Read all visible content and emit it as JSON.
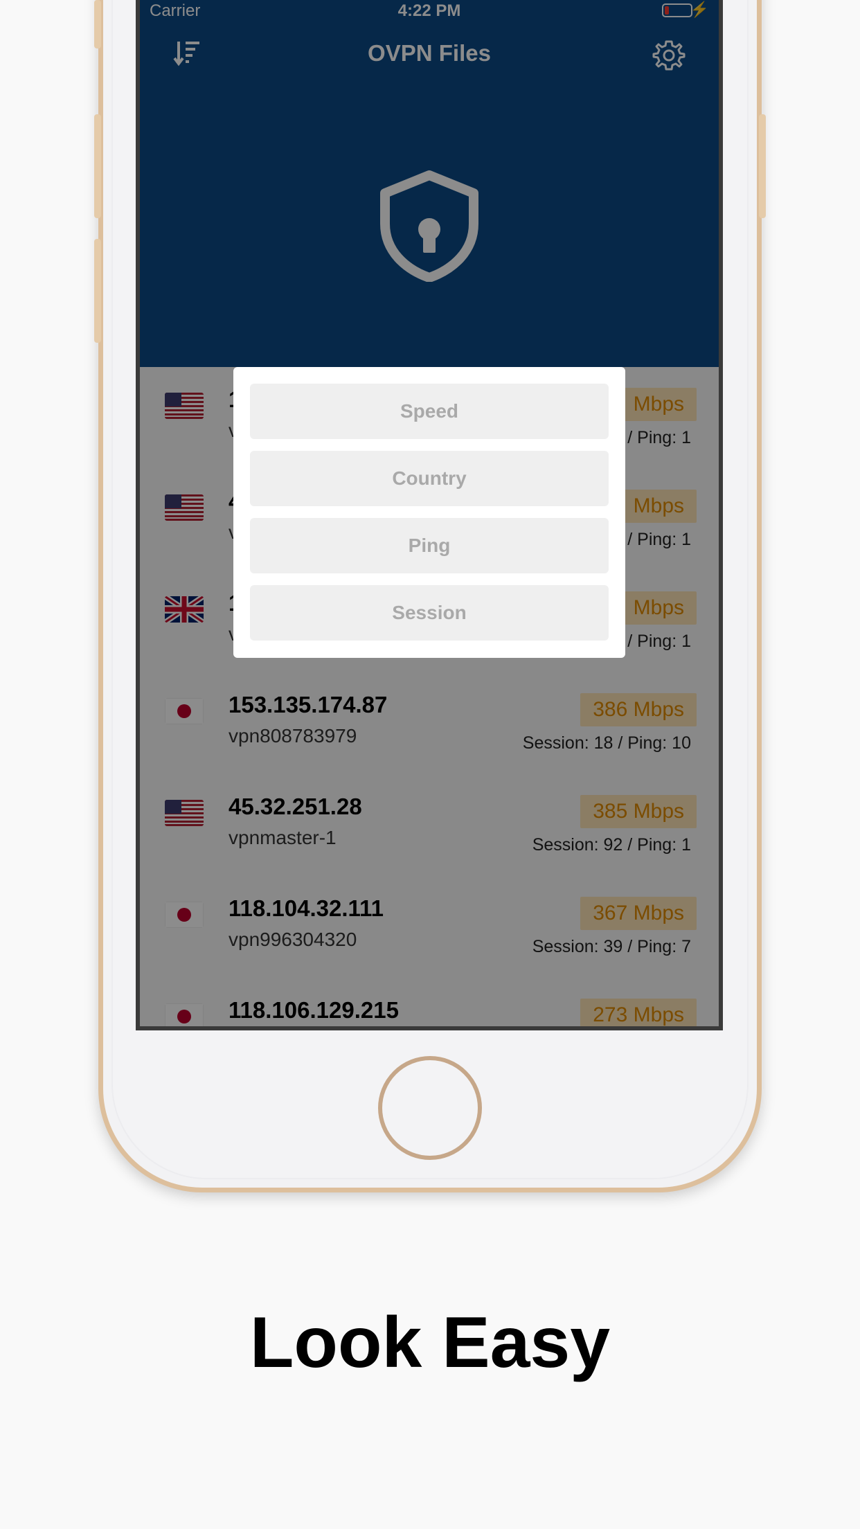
{
  "status_bar": {
    "carrier": "Carrier",
    "time": "4:22 PM"
  },
  "header": {
    "title": "OVPN Files"
  },
  "sort_menu": {
    "options": [
      "Speed",
      "Country",
      "Ping",
      "Session"
    ]
  },
  "servers": [
    {
      "country": "US",
      "ip": "1",
      "host": "v",
      "speed": "Mbps",
      "meta": "/ Ping: 1"
    },
    {
      "country": "US",
      "ip": "4",
      "host": "v",
      "speed": "Mbps",
      "meta": "/ Ping: 1"
    },
    {
      "country": "UK",
      "ip": "1",
      "host": "v",
      "speed": "Mbps",
      "meta": "/ Ping: 1"
    },
    {
      "country": "JP",
      "ip": "153.135.174.87",
      "host": "vpn808783979",
      "speed": "386 Mbps",
      "meta": "Session: 18 / Ping: 10"
    },
    {
      "country": "US",
      "ip": "45.32.251.28",
      "host": "vpnmaster-1",
      "speed": "385 Mbps",
      "meta": "Session: 92 / Ping: 1"
    },
    {
      "country": "JP",
      "ip": "118.104.32.111",
      "host": "vpn996304320",
      "speed": "367 Mbps",
      "meta": "Session: 39 / Ping: 7"
    },
    {
      "country": "JP",
      "ip": "118.106.129.215",
      "host": "",
      "speed": "273 Mbps",
      "meta": ""
    }
  ],
  "tagline": "Look Easy",
  "colors": {
    "navy": "#0b4a86",
    "speed_text": "#e08a00",
    "speed_bg": "#fde3b6",
    "phone_gold": "#ddbf9c"
  }
}
